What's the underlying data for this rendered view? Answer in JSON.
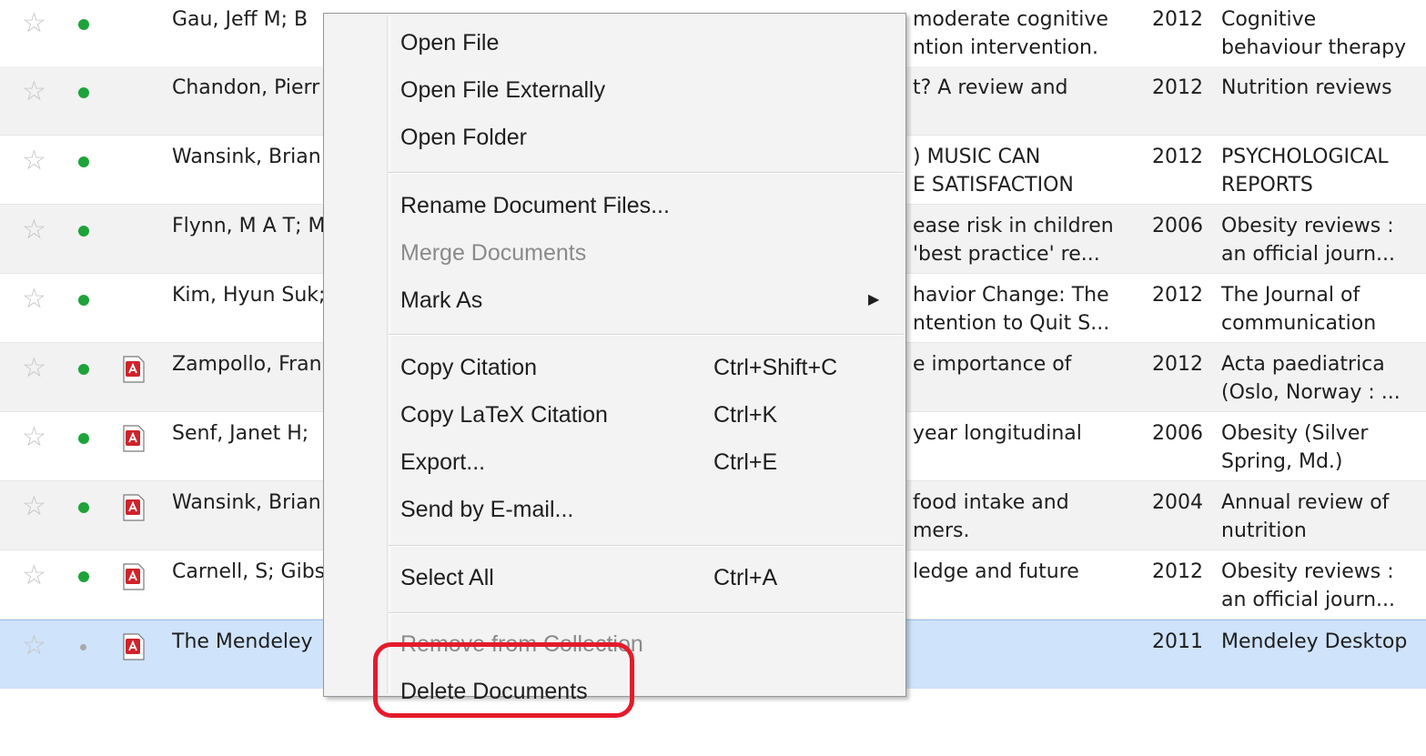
{
  "rows": [
    {
      "authors": "Gau, Jeff M; B",
      "title_l1": "moderate cognitive",
      "title_l2": "ntion intervention.",
      "year": "2012",
      "pub_l1": "Cognitive",
      "pub_l2": "behaviour therapy",
      "pdf": false,
      "read": false,
      "selected": false
    },
    {
      "authors": "Chandon, Pierr",
      "title_l1": "t? A review and",
      "title_l2": "",
      "year": "2012",
      "pub_l1": "Nutrition reviews",
      "pub_l2": "",
      "pdf": false,
      "read": false,
      "selected": false
    },
    {
      "authors": "Wansink, Brian",
      "title_l1": ") MUSIC CAN",
      "title_l2": "E SATISFACTION",
      "year": "2012",
      "pub_l1": "PSYCHOLOGICAL",
      "pub_l2": "REPORTS",
      "pdf": false,
      "read": false,
      "selected": false
    },
    {
      "authors": "Flynn, M A T; M",
      "title_l1": "ease risk in children",
      "title_l2": "'best practice' re...",
      "year": "2006",
      "pub_l1": "Obesity reviews :",
      "pub_l2": "an official journ...",
      "pdf": false,
      "read": false,
      "selected": false
    },
    {
      "authors": "Kim, Hyun Suk;",
      "title_l1": "havior Change: The",
      "title_l2": "ntention to Quit S...",
      "year": "2012",
      "pub_l1": "The Journal of",
      "pub_l2": "communication",
      "pdf": false,
      "read": false,
      "selected": false
    },
    {
      "authors": "Zampollo, Fran",
      "title_l1": "e importance of",
      "title_l2": "",
      "year": "2012",
      "pub_l1": "Acta paediatrica",
      "pub_l2": "(Oslo, Norway : ...",
      "pdf": true,
      "read": false,
      "selected": false
    },
    {
      "authors": "Senf, Janet H;",
      "title_l1": "year longitudinal",
      "title_l2": "",
      "year": "2006",
      "pub_l1": "Obesity (Silver",
      "pub_l2": "Spring, Md.)",
      "pdf": true,
      "read": false,
      "selected": false
    },
    {
      "authors": "Wansink, Brian",
      "title_l1": "food intake and",
      "title_l2": "mers.",
      "year": "2004",
      "pub_l1": "Annual review of",
      "pub_l2": "nutrition",
      "pdf": true,
      "read": false,
      "selected": false
    },
    {
      "authors": "Carnell, S; Gibs",
      "title_l1": "ledge and future",
      "title_l2": "",
      "year": "2012",
      "pub_l1": "Obesity reviews :",
      "pub_l2": "an official journ...",
      "pdf": true,
      "read": false,
      "selected": false
    },
    {
      "authors": "The Mendeley",
      "title_l1": "",
      "title_l2": "",
      "year": "2011",
      "pub_l1": "Mendeley Desktop",
      "pub_l2": "",
      "pdf": true,
      "read": true,
      "selected": true
    }
  ],
  "context_menu": {
    "open_file": "Open File",
    "open_file_externally": "Open File Externally",
    "open_folder": "Open Folder",
    "rename_document_files": "Rename Document Files...",
    "merge_documents": "Merge Documents",
    "mark_as": "Mark As",
    "copy_citation": "Copy Citation",
    "copy_citation_shortcut": "Ctrl+Shift+C",
    "copy_latex_citation": "Copy LaTeX Citation",
    "copy_latex_citation_shortcut": "Ctrl+K",
    "export": "Export...",
    "export_shortcut": "Ctrl+E",
    "send_by_email": "Send by E-mail...",
    "select_all": "Select All",
    "select_all_shortcut": "Ctrl+A",
    "remove_from_collection": "Remove from Collection",
    "delete_documents": "Delete Documents"
  },
  "colors": {
    "unread_dot": "#1ea33a",
    "selected_row": "#cfe3fb",
    "highlight_ring": "#e41b2b",
    "pdf_icon": "#d0222a"
  }
}
